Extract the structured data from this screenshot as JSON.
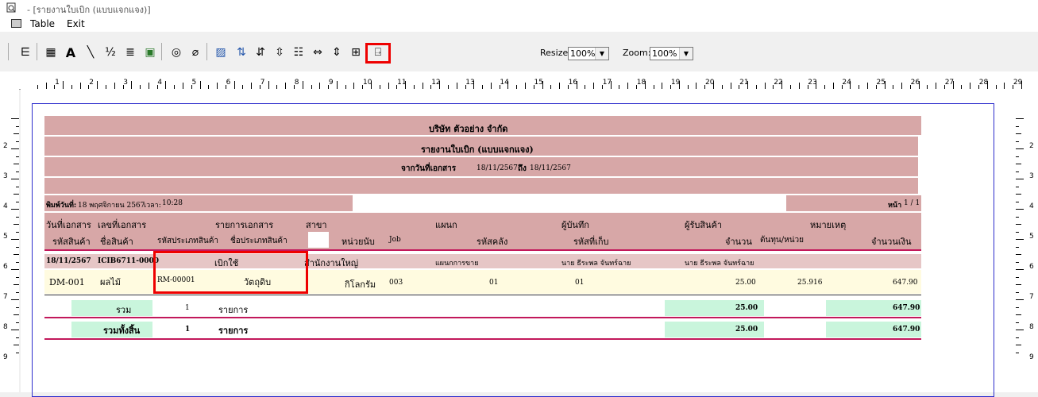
{
  "window": {
    "title": "- [รายงานใบเบิก (แบบแจกแจง)]"
  },
  "menu": {
    "items": [
      "Table",
      "Exit"
    ]
  },
  "toolbar": {
    "resize_label": "Resize:",
    "resize_value": "100%",
    "zoom_label": "Zoom:",
    "zoom_value": "100%",
    "icons": [
      "group-icon",
      "table-icon",
      "text-icon",
      "line-icon",
      "percent-icon",
      "formula-icon",
      "picture-icon",
      "stamp-icon",
      "eraser-icon",
      "chart-icon",
      "sort-icon",
      "sort2-icon",
      "sort3-icon",
      "fields-icon",
      "fit-width-icon",
      "fit-height-icon",
      "fit-page-icon",
      "exit-door-icon"
    ]
  },
  "ruler": {
    "numbers": [
      "1",
      "2",
      "3",
      "4",
      "5",
      "6",
      "7",
      "8",
      "9",
      "10",
      "11",
      "12",
      "13",
      "14",
      "15",
      "16",
      "17",
      "18",
      "19",
      "20",
      "21",
      "22",
      "23",
      "24",
      "25",
      "26",
      "27",
      "28",
      "29"
    ],
    "left_numbers": [
      "2",
      "3",
      "4",
      "5",
      "6",
      "7",
      "8",
      "9"
    ]
  },
  "report": {
    "company": "บริษัท ตัวอย่าง จำกัด",
    "title": "รายงานใบเบิก (แบบแจกแจง)",
    "date_range_label": "จากวันที่เอกสาร",
    "date_from": "18/11/2567",
    "to_label": "ถึง",
    "date_to": "18/11/2567",
    "print_label": "พิมพ์วันที่:",
    "print_date": "18 พฤศจิกายน 2567",
    "time_label": "เวลา:",
    "print_time": "10:28",
    "page_label": "หน้า",
    "page_value": "1 / 1",
    "header1": {
      "doc_date": "วันที่เอกสาร",
      "doc_no": "เลขที่เอกสาร",
      "doc_item": "รายการเอกสาร",
      "branch": "สาขา",
      "dept": "แผนก",
      "recorder": "ผู้บันทึก",
      "receiver": "ผู้รับสินค้า",
      "note": "หมายเหตุ"
    },
    "header2": {
      "product_code": "รหัสสินค้า",
      "product_name": "ชื่อสินค้า",
      "type_code": "รหัสประเภทสินค้า",
      "type_name": "ชื่อประเภทสินค้า",
      "unit": "หน่วยนับ",
      "job": "Job",
      "warehouse": "รหัสคลัง",
      "location": "รหัสที่เก็บ",
      "qty": "จำนวน",
      "cost": "ต้นทุน/หน่วย",
      "amount": "จำนวนเงิน"
    },
    "doc_row": {
      "date": "18/11/2567",
      "no": "ICIB6711-0000",
      "item": "เบิกใช้",
      "branch": "สำนักงานใหญ่",
      "dept": "แผนกการขาย",
      "recorder": "นาย ธีระพล จันทร์ฉาย",
      "receiver": "นาย ธีระพล จันทร์ฉาย"
    },
    "detail_row": {
      "code": "DM-001",
      "name": "ผลไม้",
      "type_code": "RM-00001",
      "type_name": "วัตถุดิบ",
      "unit": "กิโลกรัม",
      "job": "003",
      "warehouse": "01",
      "location": "01",
      "qty": "25.00",
      "cost": "25.916",
      "amount": "647.90"
    },
    "sum_row": {
      "label": "รวม",
      "count": "1",
      "items_label": "รายการ",
      "qty": "25.00",
      "amount": "647.90"
    },
    "total_row": {
      "label": "รวมทั้งสิ้น",
      "count": "1",
      "items_label": "รายการ",
      "qty": "25.00",
      "amount": "647.90"
    }
  },
  "colors": {
    "band": "#d7a7a7",
    "accent_line": "#c2185b",
    "highlight": "#e00000",
    "row_yellow": "#fffbe0",
    "row_green": "#c9f5dc"
  }
}
